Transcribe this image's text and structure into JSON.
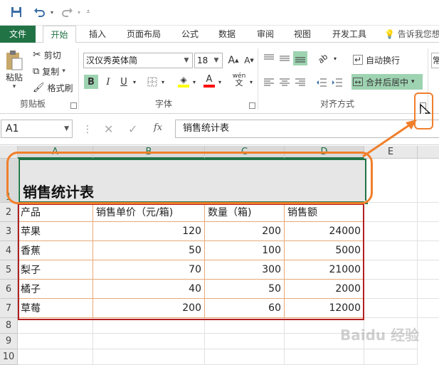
{
  "quick_access": {
    "save_icon": "save-icon",
    "undo_icon": "undo-icon",
    "redo_icon": "redo-icon",
    "customize_icon": "customize-icon"
  },
  "tabs": [
    {
      "label": "文件"
    },
    {
      "label": "开始"
    },
    {
      "label": "插入"
    },
    {
      "label": "页面布局"
    },
    {
      "label": "公式"
    },
    {
      "label": "数据"
    },
    {
      "label": "审阅"
    },
    {
      "label": "视图"
    },
    {
      "label": "开发工具"
    }
  ],
  "tell_me": "告诉我您想",
  "clipboard": {
    "paste": "粘贴",
    "cut": "剪切",
    "copy": "复制",
    "format_painter": "格式刷",
    "group_label": "剪贴板"
  },
  "font": {
    "name": "汉仪秀英体简",
    "size": "18",
    "bold": "B",
    "italic": "I",
    "underline": "U",
    "phonetic": "wén",
    "group_label": "字体",
    "highlight_color": "#ffff00",
    "font_color": "#ff0000"
  },
  "alignment": {
    "wrap_text": "自动换行",
    "merge_center": "合并后居中",
    "group_label": "对齐方式"
  },
  "number_format_partial": "常",
  "formula_bar": {
    "name_box": "A1",
    "fx": "fx",
    "content": "销售统计表"
  },
  "columns": [
    "A",
    "B",
    "C",
    "D",
    "E"
  ],
  "rows": [
    "1",
    "2",
    "3",
    "4",
    "5",
    "6",
    "7",
    "8",
    "9",
    "10"
  ],
  "sheet": {
    "title": "销售统计表",
    "headers": [
      "产品",
      "销售单价（元/箱)",
      "数量（箱)",
      "销售额"
    ],
    "data": [
      [
        "苹果",
        "120",
        "200",
        "24000"
      ],
      [
        "香蕉",
        "50",
        "100",
        "5000"
      ],
      [
        "梨子",
        "70",
        "300",
        "21000"
      ],
      [
        "橘子",
        "40",
        "50",
        "2000"
      ],
      [
        "草莓",
        "200",
        "60",
        "12000"
      ]
    ]
  },
  "watermark": "Baidu 经验",
  "accent_colors": {
    "excel_green": "#217346",
    "callout_orange": "#f07f2b",
    "table_red": "#b21f23"
  }
}
